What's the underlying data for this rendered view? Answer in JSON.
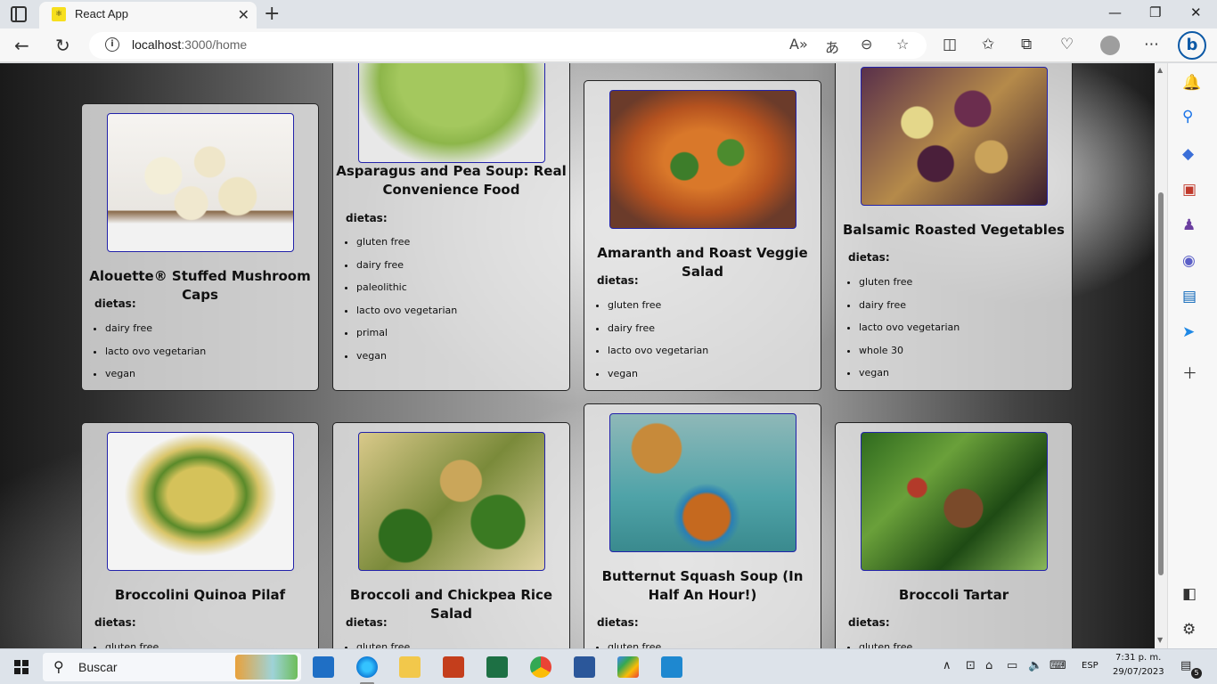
{
  "browser": {
    "tab_title": "React App",
    "tab_favicon_text": "⚛",
    "tab_close_glyph": "✕",
    "new_tab_glyph": "+",
    "window_minimize_glyph": "—",
    "window_restore_glyph": "❐",
    "window_close_glyph": "✕",
    "url_host": "localhost",
    "url_path": ":3000/home",
    "icons": [
      "back-icon",
      "refresh-icon",
      "info-icon",
      "read-aloud-icon",
      "translate-icon",
      "zoom-out-icon",
      "favorite-star-icon",
      "split-screen-icon",
      "favorites-icon",
      "collections-icon",
      "performance-icon",
      "profile-avatar",
      "more-icon",
      "bing-icon"
    ]
  },
  "recipes": [
    {
      "title": "Alouette® Stuffed Mushroom Caps",
      "diets_label": "dietas:",
      "diets": [
        "dairy free",
        "lacto ovo vegetarian",
        "vegan"
      ]
    },
    {
      "title": "Asparagus and Pea Soup: Real Convenience Food",
      "diets_label": "dietas:",
      "diets": [
        "gluten free",
        "dairy free",
        "paleolithic",
        "lacto ovo vegetarian",
        "primal",
        "vegan"
      ]
    },
    {
      "title": "Amaranth and Roast Veggie Salad",
      "diets_label": "dietas:",
      "diets": [
        "gluten free",
        "dairy free",
        "lacto ovo vegetarian",
        "vegan"
      ]
    },
    {
      "title": "Balsamic Roasted Vegetables",
      "diets_label": "dietas:",
      "diets": [
        "gluten free",
        "dairy free",
        "lacto ovo vegetarian",
        "whole 30",
        "vegan"
      ]
    },
    {
      "title": "Broccolini Quinoa Pilaf",
      "diets_label": "dietas:",
      "diets": [
        "gluten free"
      ]
    },
    {
      "title": "Broccoli and Chickpea Rice Salad",
      "diets_label": "dietas:",
      "diets": [
        "gluten free"
      ]
    },
    {
      "title": "Butternut Squash Soup (In Half An Hour!)",
      "diets_label": "dietas:",
      "diets": [
        "gluten free"
      ]
    },
    {
      "title": "Broccoli Tartar",
      "diets_label": "dietas:",
      "diets": [
        "gluten free"
      ]
    }
  ],
  "taskbar": {
    "search_placeholder": "Buscar",
    "language": "ESP",
    "time": "7:31 p. m.",
    "date": "29/07/2023",
    "notification_count": "5"
  }
}
